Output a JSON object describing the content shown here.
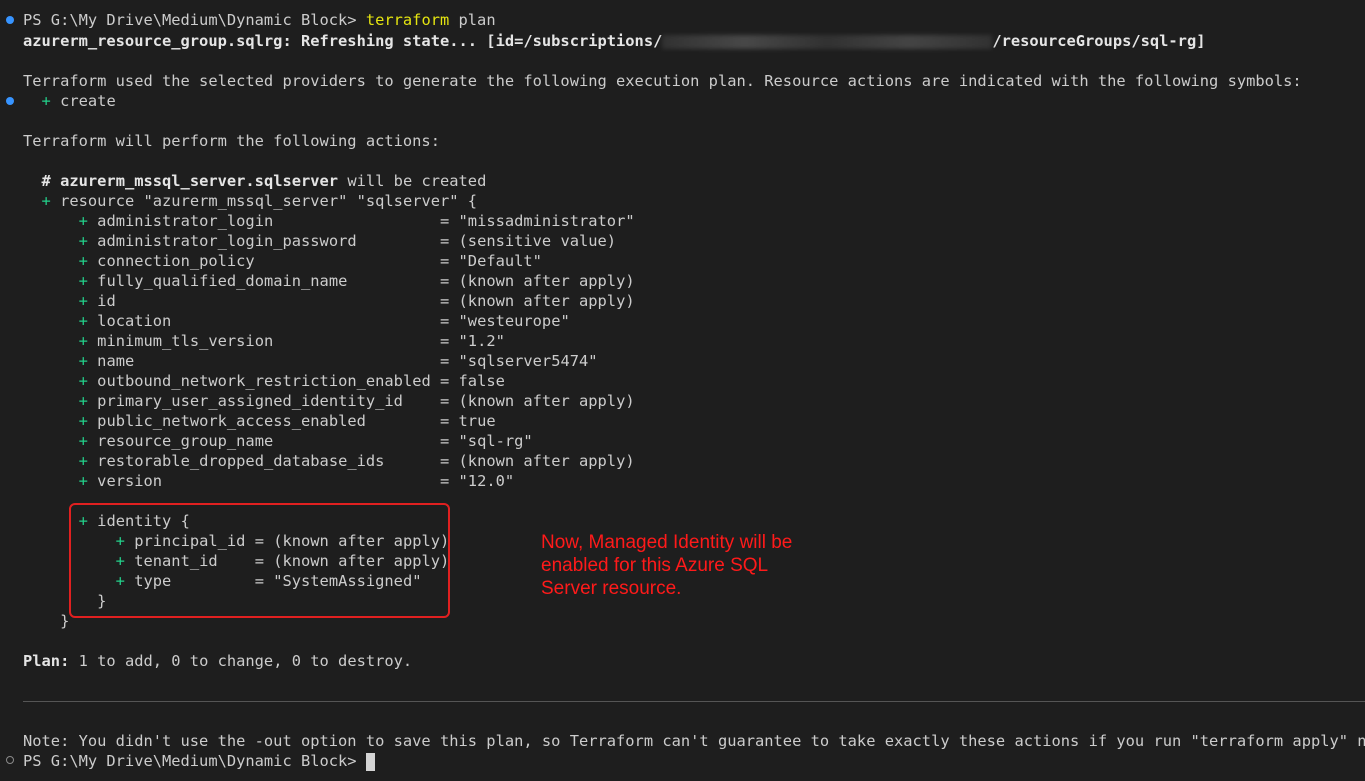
{
  "prompt": {
    "prefix": "PS G:\\My Drive\\Medium\\Dynamic Block> ",
    "command": "terraform",
    "args": " plan"
  },
  "refresh": {
    "left": "azurerm_resource_group.sqlrg: Refreshing state... [id=/subscriptions/",
    "right": "/resourceGroups/sql-rg]"
  },
  "intro": "Terraform used the selected providers to generate the following execution plan. Resource actions are indicated with the following symbols:",
  "symbol_create": "create",
  "perform": "Terraform will perform the following actions:",
  "resource_comment": {
    "hash": "# ",
    "name": "azurerm_mssql_server.sqlserver",
    "suffix": " will be created"
  },
  "resource_open": "resource \"azurerm_mssql_server\" \"sqlserver\" {",
  "attributes": [
    "administrator_login                  = \"missadministrator\"",
    "administrator_login_password         = (sensitive value)",
    "connection_policy                    = \"Default\"",
    "fully_qualified_domain_name          = (known after apply)",
    "id                                   = (known after apply)",
    "location                             = \"westeurope\"",
    "minimum_tls_version                  = \"1.2\"",
    "name                                 = \"sqlserver5474\"",
    "outbound_network_restriction_enabled = false",
    "primary_user_assigned_identity_id    = (known after apply)",
    "public_network_access_enabled        = true",
    "resource_group_name                  = \"sql-rg\"",
    "restorable_dropped_database_ids      = (known after apply)",
    "version                              = \"12.0\""
  ],
  "identity": {
    "open": "identity {",
    "attributes": [
      "principal_id = (known after apply)",
      "tenant_id    = (known after apply)",
      "type         = \"SystemAssigned\""
    ],
    "close": "}"
  },
  "resource_close": "}",
  "plan": {
    "label": "Plan:",
    "summary": " 1 to add, 0 to change, 0 to destroy."
  },
  "note": "Note: You didn't use the -out option to save this plan, so Terraform can't guarantee to take exactly these actions if you run \"terraform apply\" now.",
  "final_prompt": "PS G:\\My Drive\\Medium\\Dynamic Block> ",
  "annotation": "Now, Managed Identity will be enabled for this Azure SQL Server resource.",
  "colors": {
    "background": "#1e1e1e",
    "text": "#cccccc",
    "plus": "#23d18b",
    "command": "#e5e510",
    "annotation": "#ff1a1a",
    "box": "#e02020",
    "dot": "#3794ff"
  }
}
